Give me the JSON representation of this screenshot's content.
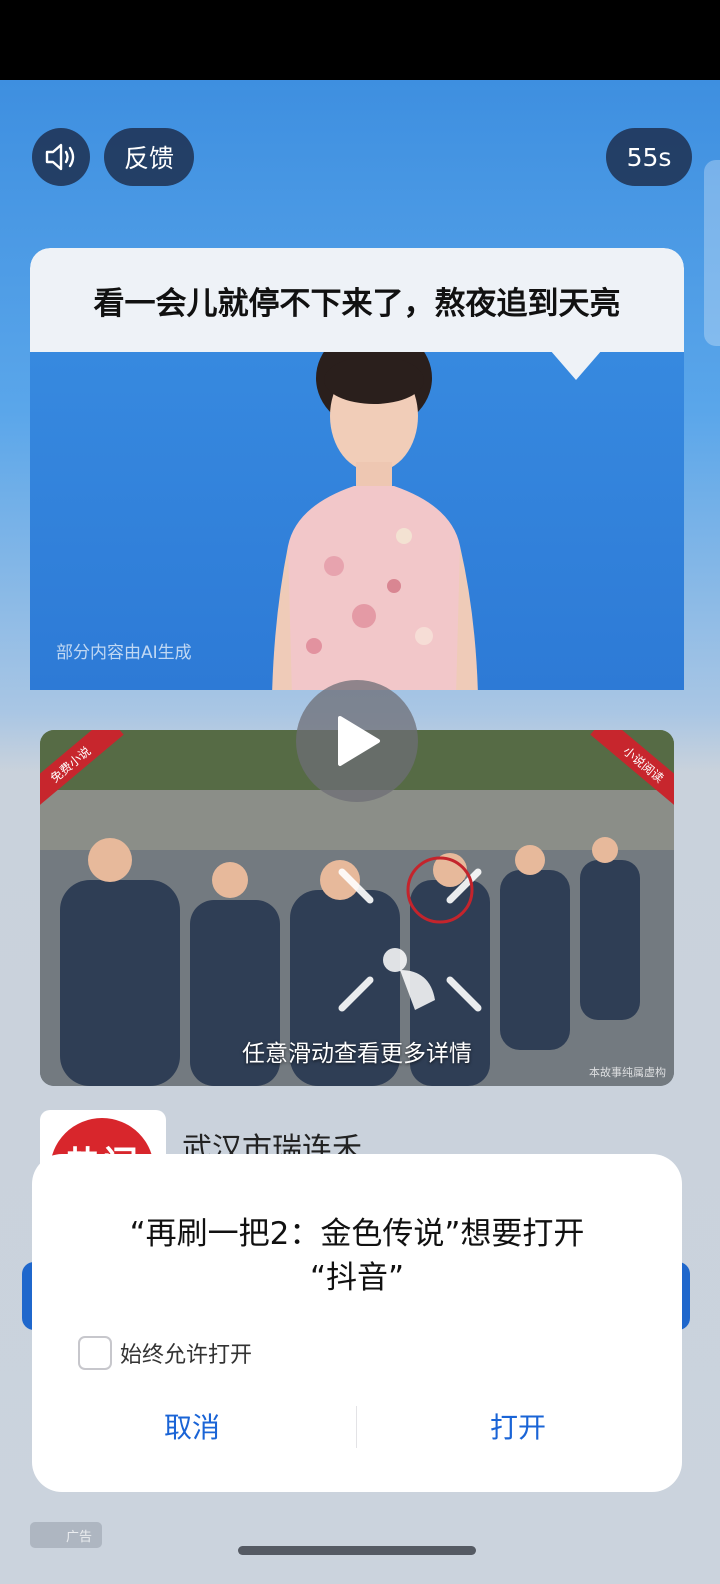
{
  "top_controls": {
    "sound_icon": "speaker-icon",
    "feedback_label": "反馈",
    "countdown": "55s"
  },
  "video": {
    "caption": "看一会儿就停不下来了，熬夜追到天亮",
    "ai_notice": "部分内容由AI生成",
    "play_icon": "play-icon"
  },
  "promo": {
    "badge_left": "免费小说",
    "badge_right": "小说阅读",
    "swipe_hint": "任意滑动查看更多详情",
    "watermark": "本故事纯属虚构"
  },
  "advertiser": {
    "icon_text": "热门",
    "name": "武汉市瑞连禾"
  },
  "dialog": {
    "title_line1": "“再刷一把2：金色传说”想要打开",
    "title_line2": "“抖音”",
    "checkbox_label": "始终允许打开",
    "checkbox_checked": false,
    "cancel_label": "取消",
    "open_label": "打开",
    "accent_color": "#1a64d6"
  },
  "footer": {
    "ad_label": "广告"
  }
}
